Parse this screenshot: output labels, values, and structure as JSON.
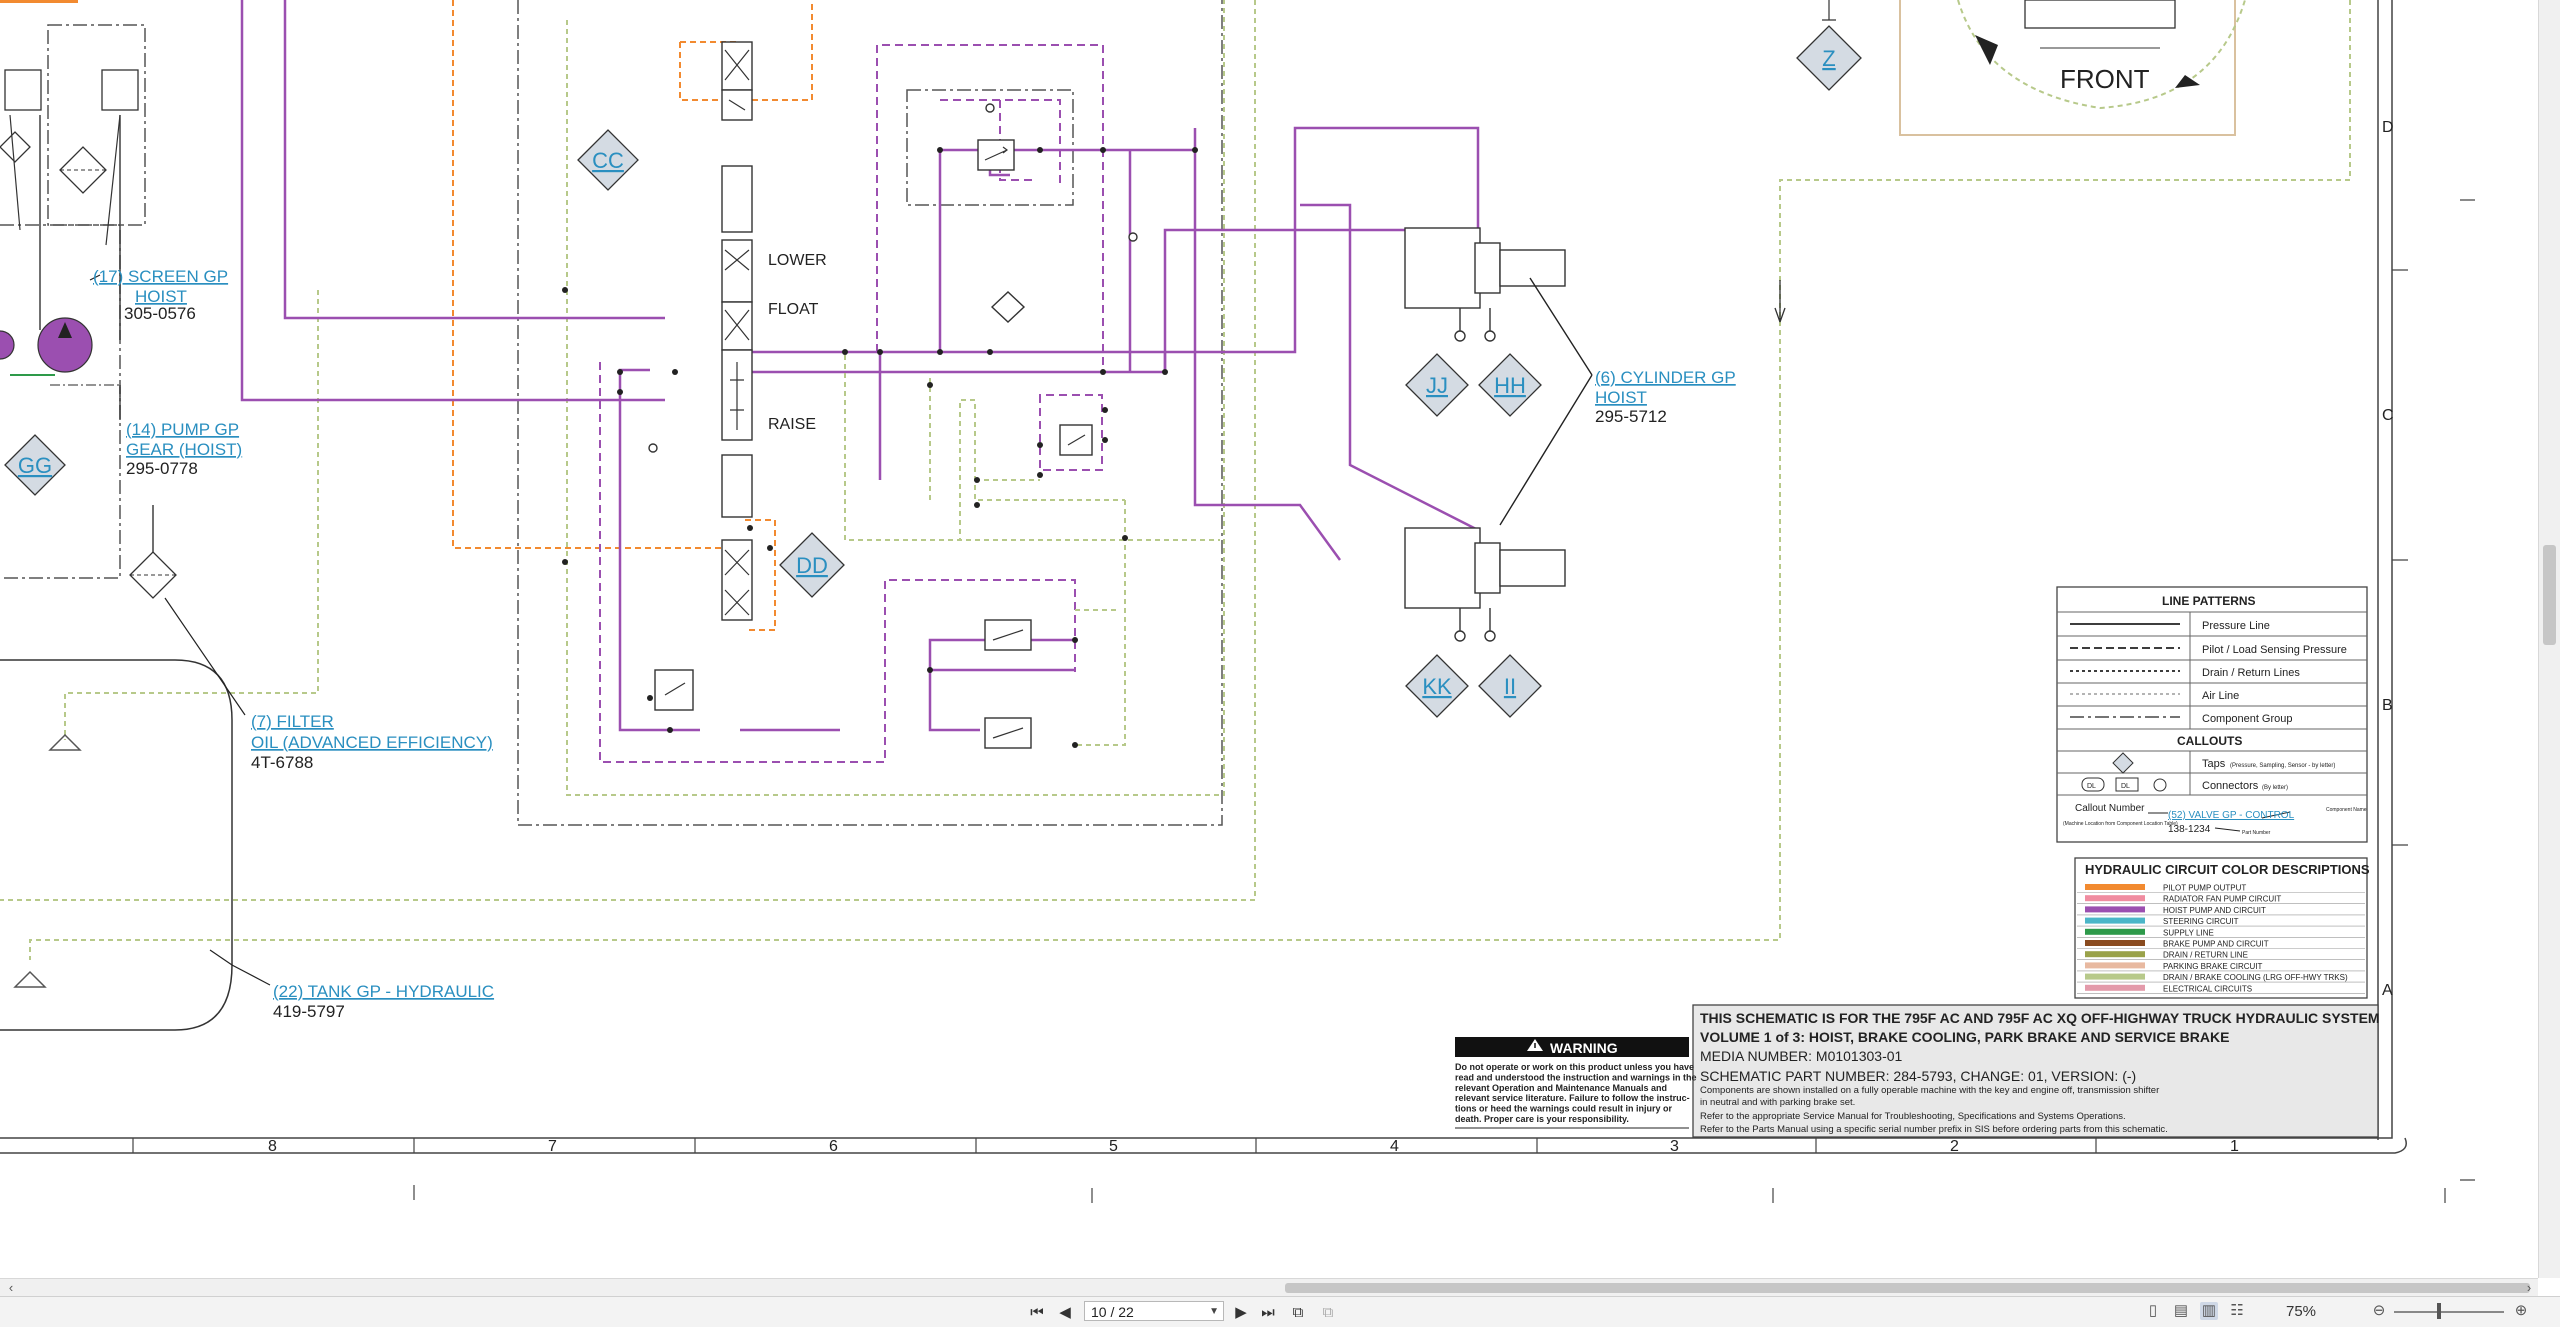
{
  "schematic": {
    "labels": {
      "screen_gp": "(17) SCREEN GP",
      "screen_hoist": "HOIST",
      "screen_pn": "305-0576",
      "pump_gp": "(14) PUMP GP",
      "pump_gear": "GEAR (HOIST)",
      "pump_pn": "295-0778",
      "filter": "(7) FILTER",
      "filter_oil": "OIL (ADVANCED EFFICIENCY)",
      "filter_pn": "4T-6788",
      "tank": "(22) TANK GP - HYDRAULIC",
      "tank_pn": "419-5797",
      "cylinder": "(6) CYLINDER GP",
      "cylinder_hoist": "HOIST",
      "cylinder_pn": "295-5712",
      "lower": "LOWER",
      "float": "FLOAT",
      "raise": "RAISE",
      "front": "FRONT"
    },
    "callouts": [
      "CC",
      "DD",
      "GG",
      "JJ",
      "HH",
      "KK",
      "II",
      "Z"
    ],
    "column_numbers": [
      "8",
      "7",
      "6",
      "5",
      "4",
      "3",
      "2",
      "1"
    ],
    "row_letters": [
      "D",
      "C",
      "B",
      "A"
    ],
    "legend": {
      "line_patterns_title": "LINE PATTERNS",
      "patterns": [
        "Pressure Line",
        "Pilot / Load Sensing Pressure",
        "Drain / Return Lines",
        "Air Line",
        "Component Group"
      ],
      "callouts_title": "CALLOUTS",
      "taps": "Taps",
      "taps_note": "(Pressure, Sampling, Sensor - by letter)",
      "connectors": "Connectors",
      "connectors_note": "(By letter)",
      "connector_dl": "DL",
      "callout_number": "Callout Number",
      "callout_number_note": "(Machine Location from Component Location Table)",
      "example_link": "(52) VALVE GP - CONTROL",
      "example_pn": "138-1234",
      "component_name": "Component Name",
      "part_number": "Part Number"
    },
    "color_desc": {
      "title": "HYDRAULIC CIRCUIT COLOR DESCRIPTIONS",
      "items": [
        {
          "label": "PILOT PUMP OUTPUT",
          "color": "#f28a30"
        },
        {
          "label": "RADIATOR FAN PUMP CIRCUIT",
          "color": "#f08ca0"
        },
        {
          "label": "HOIST PUMP AND CIRCUIT",
          "color": "#9b4fb0"
        },
        {
          "label": "STEERING CIRCUIT",
          "color": "#4bb6c8"
        },
        {
          "label": "SUPPLY LINE",
          "color": "#2e9a4a"
        },
        {
          "label": "BRAKE PUMP AND CIRCUIT",
          "color": "#8a4b1f"
        },
        {
          "label": "DRAIN / RETURN LINE",
          "color": "#9aa24a"
        },
        {
          "label": "PARKING BRAKE CIRCUIT",
          "color": "#e8b9a0"
        },
        {
          "label": "DRAIN / BRAKE COOLING (LRG OFF-HWY TRKS)",
          "color": "#b7c98a"
        },
        {
          "label": "ELECTRICAL CIRCUITS",
          "color": "#e39aaa"
        }
      ]
    },
    "warning": {
      "title": "WARNING",
      "text_lines": [
        "Do not operate or work on this product unless you have",
        "read and understood the instruction and warnings in the",
        "relevant Operation and Maintenance Manuals and",
        "relevant service literature. Failure to follow the instruc-",
        "tions or heed the warnings could result in injury or",
        "death. Proper care is your responsibility."
      ]
    },
    "title_block": {
      "line1": "THIS SCHEMATIC IS FOR THE 795F AC AND 795F AC XQ OFF-HIGHWAY TRUCK HYDRAULIC SYSTEM",
      "line2": "VOLUME 1 of 3: HOIST, BRAKE COOLING, PARK BRAKE AND SERVICE BRAKE",
      "media": "MEDIA NUMBER: M0101303-01",
      "part": "SCHEMATIC PART NUMBER: 284-5793, CHANGE: 01, VERSION: (-)",
      "note1": "Components are shown installed on a fully operable machine with the key and engine off, transmission shifter",
      "note2": "in neutral and with parking brake set.",
      "note3": "Refer to the appropriate Service Manual for Troubleshooting, Specifications and Systems Operations.",
      "note4": "Refer to the Parts Manual using a specific serial number prefix in SIS before ordering parts from this schematic."
    },
    "colors": {
      "hoist": "#9b4fb0",
      "pilot": "#f28a30",
      "drain": "#b7c98a",
      "link": "#2a8fc0",
      "diamond": "#d4dbe3"
    }
  },
  "statusbar": {
    "page": "10 / 22",
    "zoom": "75%"
  }
}
